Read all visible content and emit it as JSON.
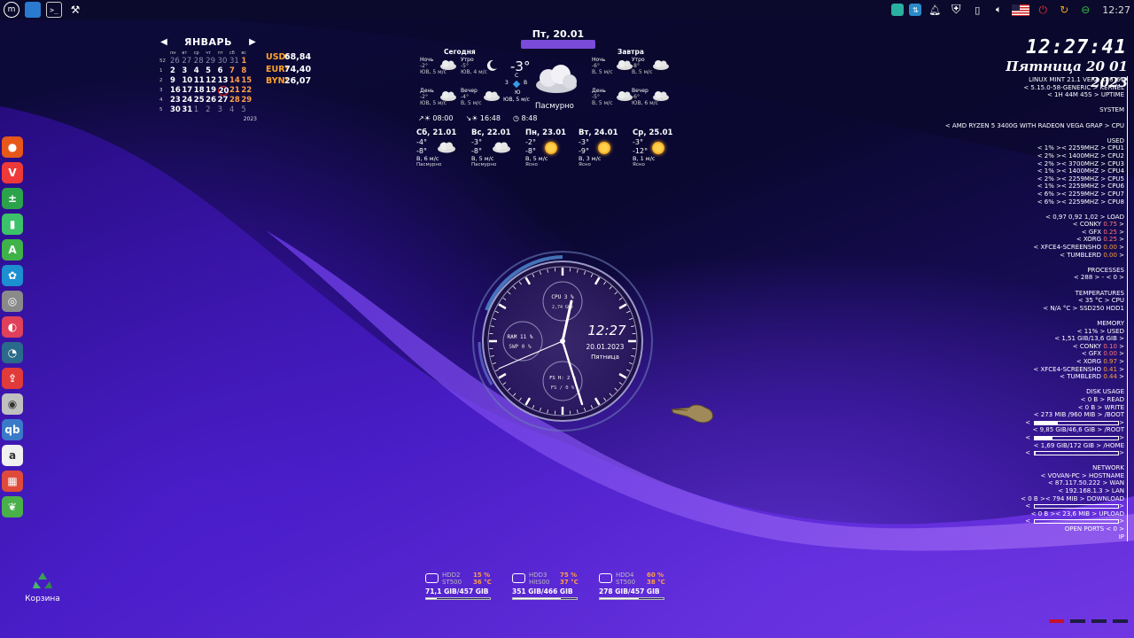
{
  "panel": {
    "left_icons": [
      "mint-menu-icon",
      "files-icon",
      "terminal-icon",
      "tools-icon"
    ],
    "clock": "12:27",
    "tray_icons": [
      "teal-app-icon",
      "network-icon",
      "bell-icon",
      "shield-icon",
      "battery-icon",
      "volume-icon",
      "us-flag-icon",
      "power-icon",
      "refresh-icon",
      "update-icon"
    ]
  },
  "dock": {
    "items": [
      {
        "name": "firefox-icon",
        "glyph": "●",
        "color": "#e8571a"
      },
      {
        "name": "vivaldi-icon",
        "glyph": "V",
        "color": "#ef3939"
      },
      {
        "name": "calculator-icon",
        "glyph": "±",
        "color": "#2aa34a"
      },
      {
        "name": "microphone-icon",
        "glyph": "▮",
        "color": "#3cc26a"
      },
      {
        "name": "appimage-icon",
        "glyph": "A",
        "color": "#3fb24a"
      },
      {
        "name": "pinwheel-icon",
        "glyph": "✿",
        "color": "#1c8fd0"
      },
      {
        "name": "disk-settings-icon",
        "glyph": "◎",
        "color": "#8a8a8a"
      },
      {
        "name": "chart-app-icon",
        "glyph": "◐",
        "color": "#e0405a"
      },
      {
        "name": "speedometer-icon",
        "glyph": "◔",
        "color": "#2a6a8a"
      },
      {
        "name": "upload-icon",
        "glyph": "⇪",
        "color": "#e03a3a"
      },
      {
        "name": "disc-burner-icon",
        "glyph": "◉",
        "color": "#c0c0c0"
      },
      {
        "name": "qbittorrent-icon",
        "glyph": "qb",
        "color": "#3a7ac8"
      },
      {
        "name": "audacious-icon",
        "glyph": "a",
        "color": "#f0f0f0"
      },
      {
        "name": "apps-grid-icon",
        "glyph": "▦",
        "color": "#e04a3a"
      },
      {
        "name": "cherry-icon",
        "glyph": "❦",
        "color": "#4ab04a"
      }
    ]
  },
  "trash": {
    "label": "Корзина"
  },
  "calendar": {
    "month": "ЯНВАРЬ",
    "year": "2023",
    "dow": [
      "",
      "пн",
      "вт",
      "ср",
      "чт",
      "пт",
      "сб",
      "вс"
    ],
    "weeks": [
      {
        "wk": "52",
        "days": [
          [
            "26",
            "dim"
          ],
          [
            "27",
            "dim"
          ],
          [
            "28",
            "dim"
          ],
          [
            "29",
            "dim"
          ],
          [
            "30",
            "dim"
          ],
          [
            "31",
            "dim"
          ],
          [
            "1",
            "we"
          ]
        ]
      },
      {
        "wk": "1",
        "days": [
          [
            "2",
            ""
          ],
          [
            "3",
            ""
          ],
          [
            "4",
            ""
          ],
          [
            "5",
            ""
          ],
          [
            "6",
            ""
          ],
          [
            "7",
            "we"
          ],
          [
            "8",
            "we"
          ]
        ]
      },
      {
        "wk": "2",
        "days": [
          [
            "9",
            ""
          ],
          [
            "10",
            ""
          ],
          [
            "11",
            ""
          ],
          [
            "12",
            ""
          ],
          [
            "13",
            ""
          ],
          [
            "14",
            "we"
          ],
          [
            "15",
            "we"
          ]
        ]
      },
      {
        "wk": "3",
        "days": [
          [
            "16",
            ""
          ],
          [
            "17",
            ""
          ],
          [
            "18",
            ""
          ],
          [
            "19",
            ""
          ],
          [
            "20",
            "today"
          ],
          [
            "21",
            "we"
          ],
          [
            "22",
            "we"
          ]
        ]
      },
      {
        "wk": "4",
        "days": [
          [
            "23",
            ""
          ],
          [
            "24",
            ""
          ],
          [
            "25",
            ""
          ],
          [
            "26",
            ""
          ],
          [
            "27",
            ""
          ],
          [
            "28",
            "we"
          ],
          [
            "29",
            "we"
          ]
        ]
      },
      {
        "wk": "5",
        "days": [
          [
            "30",
            ""
          ],
          [
            "31",
            ""
          ],
          [
            "1",
            "dim"
          ],
          [
            "2",
            "dim"
          ],
          [
            "3",
            "dim"
          ],
          [
            "4",
            "dim"
          ],
          [
            "5",
            "dim"
          ]
        ]
      }
    ]
  },
  "currency": [
    {
      "code": "USD:",
      "value": "68,84"
    },
    {
      "code": "EUR:",
      "value": "74,40"
    },
    {
      "code": "BYN:",
      "value": "26,07"
    }
  ],
  "weather": {
    "date": "Пт, 20.01",
    "today_label": "Сегодня",
    "tomorrow_label": "Завтра",
    "today": {
      "night": {
        "label": "Ночь",
        "temp": "-2°",
        "wind": "ЮВ, 5 м/с"
      },
      "morning": {
        "label": "Утро",
        "temp": "-5°",
        "wind": "ЮВ, 4 м/с"
      },
      "day": {
        "label": "День",
        "temp": "-2°",
        "wind": "ЮВ, 5 м/с"
      },
      "evening": {
        "label": "Вечер",
        "temp": "-4°",
        "wind": "В, 5 м/с"
      }
    },
    "tomorrow": {
      "night": {
        "label": "Ночь",
        "temp": "-6°",
        "wind": "В, 5 м/с"
      },
      "morning": {
        "label": "Утро",
        "temp": "-8°",
        "wind": "В, 5 м/с"
      },
      "day": {
        "label": "День",
        "temp": "-5°",
        "wind": "В, 5 м/с"
      },
      "evening": {
        "label": "Вечер",
        "temp": "-6°",
        "wind": "ЮВ, 6 м/с"
      }
    },
    "now": {
      "temp": "-3°",
      "feels": "С",
      "description": "Пасмурно",
      "compass_s": "Ю",
      "compass_w": "3",
      "compass_e": "В",
      "wind": "ЮВ, 5 м/с"
    },
    "sunrise": "08:00",
    "sunset": "16:48",
    "daylight": "8:48",
    "forecast": [
      {
        "title": "Сб, 21.01",
        "t_hi": "-4°",
        "t_lo": "-8°",
        "wind": "В, 6 м/с",
        "desc": "Пасмурно",
        "icon": "cloud"
      },
      {
        "title": "Вс, 22.01",
        "t_hi": "-3°",
        "t_lo": "-8°",
        "wind": "В, 5 м/с",
        "desc": "Пасмурно",
        "icon": "cloud"
      },
      {
        "title": "Пн, 23.01",
        "t_hi": "-2°",
        "t_lo": "-8°",
        "wind": "В, 5 м/с",
        "desc": "Ясно",
        "icon": "sun"
      },
      {
        "title": "Вт, 24.01",
        "t_hi": "-3°",
        "t_lo": "-9°",
        "wind": "В, 3 м/с",
        "desc": "Ясно",
        "icon": "sun"
      },
      {
        "title": "Ср, 25.01",
        "t_hi": "-3°",
        "t_lo": "-12°",
        "wind": "В, 1 м/с",
        "desc": "Ясно",
        "icon": "sun"
      }
    ]
  },
  "clock": {
    "time": "12:27",
    "date": "20.01.2023",
    "weekday": "Пятница",
    "cpu": "CPU 3 %",
    "cpu_freq": "2,74 GHz",
    "ram": "RAM 11 %",
    "swp": "SWP 0 %",
    "fs_h": "FS H: 2 %",
    "fs_r": "FS / 0 %"
  },
  "sysinfo": {
    "time": "12:27:41",
    "date": "Пятница 20 01 2023",
    "lines": [
      {
        "t": "LINUX MINT 21.1 VERA X86_64"
      },
      {
        "t": "< 5.15.0-58-GENERIC > KERNEL"
      },
      {
        "t": "< 1H 44M 45S > UPTIME"
      },
      {
        "t": ""
      },
      {
        "t": "SYSTEM",
        "head": true
      },
      {
        "t": ""
      },
      {
        "t": "< AMD RYZEN 5 3400G WITH RADEON VEGA GRAP > CPU"
      },
      {
        "t": ""
      },
      {
        "t": "USED",
        "head": true
      },
      {
        "t": "< 1% >< 2259MHZ >  CPU1"
      },
      {
        "t": "< 2% >< 1400MHZ >  CPU2"
      },
      {
        "t": "< 2% >< 3700MHZ >  CPU3"
      },
      {
        "t": "< 1% >< 1400MHZ >  CPU4"
      },
      {
        "t": "< 2% >< 2259MHZ >  CPU5"
      },
      {
        "t": "< 1% >< 2259MHZ >  CPU6"
      },
      {
        "t": "< 6% >< 2259MHZ >  CPU7"
      },
      {
        "t": "< 6% >< 2259MHZ >  CPU8"
      },
      {
        "t": ""
      },
      {
        "t": "< 0,97 0,92 1,02  > LOAD"
      },
      {
        "t": "< CONKY",
        "v": "0.75",
        "vc": "p"
      },
      {
        "t": "< GFX",
        "v": "0.25",
        "vc": "p"
      },
      {
        "t": "< XORG",
        "v": "0.25",
        "vc": "p"
      },
      {
        "t": "< XFCE4-SCREENSHO",
        "v": "0.00",
        "vc": "v"
      },
      {
        "t": "< TUMBLERD",
        "v": "0.00",
        "vc": "v"
      },
      {
        "t": ""
      },
      {
        "t": "PROCESSES",
        "head": true
      },
      {
        "t": "< 288  > - < 0  >"
      },
      {
        "t": ""
      },
      {
        "t": "TEMPERATURES",
        "head": true
      },
      {
        "t": "< 35 °C > CPU"
      },
      {
        "t": "< N/A °C > SSD250 HDD1"
      },
      {
        "t": ""
      },
      {
        "t": "MEMORY",
        "head": true
      },
      {
        "t": "< 11% > USED"
      },
      {
        "t": "< 1,51 GIB/13,6 GIB >"
      },
      {
        "t": "< CONKY",
        "v": "0.10",
        "vc": "p"
      },
      {
        "t": "< GFX",
        "v": "0.00",
        "vc": "p"
      },
      {
        "t": "< XORG",
        "v": "0.97",
        "vc": "v"
      },
      {
        "t": "< XFCE4-SCREENSHO",
        "v": "0.41",
        "vc": "v"
      },
      {
        "t": "< TUMBLERD",
        "v": "0.44",
        "vc": "v"
      },
      {
        "t": ""
      },
      {
        "t": "DISK USAGE",
        "head": true
      },
      {
        "t": "< 0 B    > READ"
      },
      {
        "t": "< 0 B    > WRITE"
      },
      {
        "t": "< 273 MIB /960 MIB  > /BOOT"
      },
      {
        "bar": 0.28
      },
      {
        "t": "< 9,85 GIB/46,6 GIB > /ROOT"
      },
      {
        "bar": 0.21
      },
      {
        "t": "< 1,69 GIB/172 GIB  > /HOME"
      },
      {
        "bar": 0.01
      },
      {
        "t": ""
      },
      {
        "t": "NETWORK",
        "head": true
      },
      {
        "t": "< VOVAN-PC > HOSTNAME"
      },
      {
        "t": "< 87.117.50.222 > WAN"
      },
      {
        "t": "< 192.168.1.3 > LAN"
      },
      {
        "t": "< 0 B    >< 794 MIB  > DOWNLOAD"
      },
      {
        "bar": 0.0
      },
      {
        "t": "< 0 B    >< 23,6 MIB > UPLOAD"
      },
      {
        "bar": 0.0
      },
      {
        "t": "OPEN PORTS < 0 >"
      },
      {
        "t": "IP"
      }
    ]
  },
  "disks": [
    {
      "name": "HDD2",
      "model": "ST500",
      "pct": "15 %",
      "temp": "36 °C",
      "size": "71,1 GIB/457 GIB",
      "used": 0.16
    },
    {
      "name": "HDD3",
      "model": "HitS00",
      "pct": "75 %",
      "temp": "37 °C",
      "size": "351 GIB/466 GIB",
      "used": 0.75
    },
    {
      "name": "HDD4",
      "model": "ST500",
      "pct": "60 %",
      "temp": "38 °C",
      "size": "278 GIB/457 GIB",
      "used": 0.61
    }
  ],
  "workspaces": [
    {
      "color": "#c4122a"
    },
    {
      "color": "#1d1d40"
    },
    {
      "color": "#1d1d40"
    },
    {
      "color": "#1d1d40"
    }
  ]
}
